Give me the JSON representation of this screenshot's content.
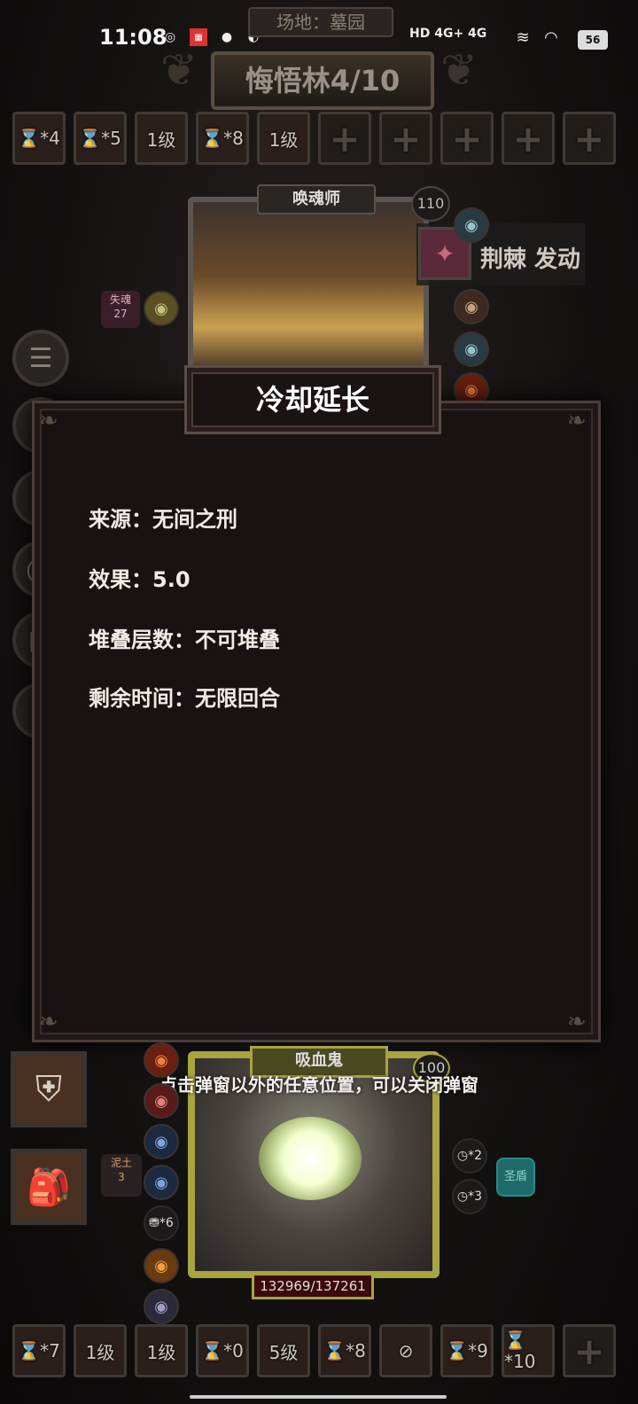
{
  "status_bar": {
    "time": "11:08",
    "network": "HD 4G+ 4G",
    "battery": "56"
  },
  "header": {
    "venue": "场地：墓园",
    "stage": "悔悟林4/10"
  },
  "top_skills": [
    {
      "label": "⌛*4",
      "type": "filled"
    },
    {
      "label": "⌛*5",
      "type": "filled"
    },
    {
      "label": "1级",
      "type": "filled"
    },
    {
      "label": "⌛*8",
      "type": "filled"
    },
    {
      "label": "1级",
      "type": "filled"
    },
    {
      "label": "+",
      "type": "empty"
    },
    {
      "label": "+",
      "type": "empty"
    },
    {
      "label": "+",
      "type": "empty"
    },
    {
      "label": "+",
      "type": "empty"
    },
    {
      "label": "+",
      "type": "empty"
    }
  ],
  "enemy": {
    "name": "唤魂师",
    "level": "110",
    "trigger_text": "荆棘 发动",
    "soul_loss_label": "失魂",
    "soul_loss_value": "27"
  },
  "popup": {
    "title": "冷却延长",
    "source": "来源：无间之刑",
    "effect": "效果：5.0",
    "stack": "堆叠层数：不可堆叠",
    "remaining": "剩余时间：无限回合"
  },
  "hint": "点击弹窗以外的任意位置，可以关闭弹窗",
  "player": {
    "name": "吸血鬼",
    "level": "100",
    "hp": "132969/137261",
    "mud_label": "泥土",
    "mud_value": "3",
    "coin_label": "*6",
    "cd2": "*2",
    "cd3": "*3",
    "holy_shield": "圣盾"
  },
  "bottom_skills": [
    {
      "label": "⌛*7"
    },
    {
      "label": "1级"
    },
    {
      "label": "1级"
    },
    {
      "label": "⌛*0"
    },
    {
      "label": "5级"
    },
    {
      "label": "⌛*8"
    },
    {
      "label": "⊘"
    },
    {
      "label": "⌛*9"
    },
    {
      "label": "⌛*10"
    },
    {
      "label": "+"
    }
  ],
  "colors": {
    "popup_bg": "#1a1113",
    "frame_gold": "#a8a440",
    "text_white": "#f1ebe5"
  }
}
